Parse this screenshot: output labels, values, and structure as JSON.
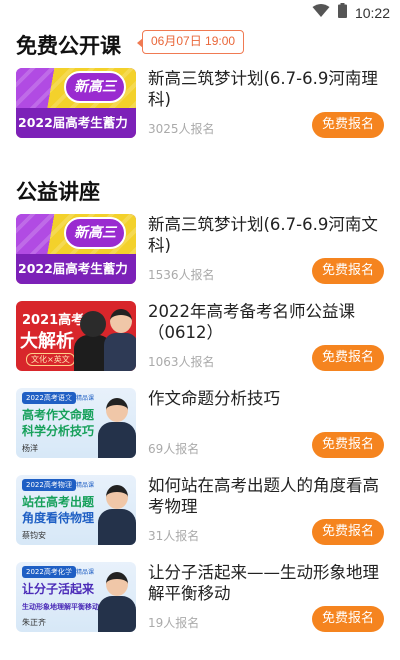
{
  "status_bar": {
    "time": "10:22",
    "icons": [
      "wifi-icon",
      "battery-icon"
    ]
  },
  "free_section": {
    "title": "免费公开课",
    "date_badge": "06月07日 19:00",
    "courses": [
      {
        "thumb_main": "新高三",
        "thumb_band": "2022届高考生蓄力",
        "title": "新高三筑梦计划(6.7-6.9河南理科)",
        "enrolled": "3025人报名",
        "button": "免费报名"
      }
    ]
  },
  "public_section": {
    "title": "公益讲座",
    "courses": [
      {
        "thumb_main": "新高三",
        "thumb_band": "2022届高考生蓄力",
        "title": "新高三筑梦计划(6.7-6.9河南文科)",
        "enrolled": "1536人报名",
        "button": "免费报名"
      },
      {
        "thumb_line1": "2021高考",
        "thumb_line2": "大解析",
        "thumb_sub": "文化×英文",
        "title": "2022年高考备考名师公益课（0612）",
        "enrolled": "1063人报名",
        "button": "免费报名"
      },
      {
        "thumb_tag": "2022高考语文",
        "thumb_tag2": "名师精品课",
        "thumb_l1": "高考作文命题",
        "thumb_l2": "科学分析技巧",
        "thumb_name": "杨洋",
        "title": "作文命题分析技巧",
        "enrolled": "69人报名",
        "button": "免费报名"
      },
      {
        "thumb_tag": "2022高考物理",
        "thumb_tag2": "名师精品课",
        "thumb_l1": "站在高考出题",
        "thumb_l2": "角度看待物理",
        "thumb_name": "蔡钧安",
        "title": "如何站在高考出题人的角度看高考物理",
        "enrolled": "31人报名",
        "button": "免费报名"
      },
      {
        "thumb_tag": "2022高考化学",
        "thumb_tag2": "名师精品课",
        "thumb_l1": "让分子活起来",
        "thumb_l2": "生动形象地理解平衡移动",
        "thumb_name": "朱正齐",
        "title": "让分子活起来——生动形象地理解平衡移动",
        "enrolled": "19人报名",
        "button": "免费报名"
      }
    ]
  }
}
